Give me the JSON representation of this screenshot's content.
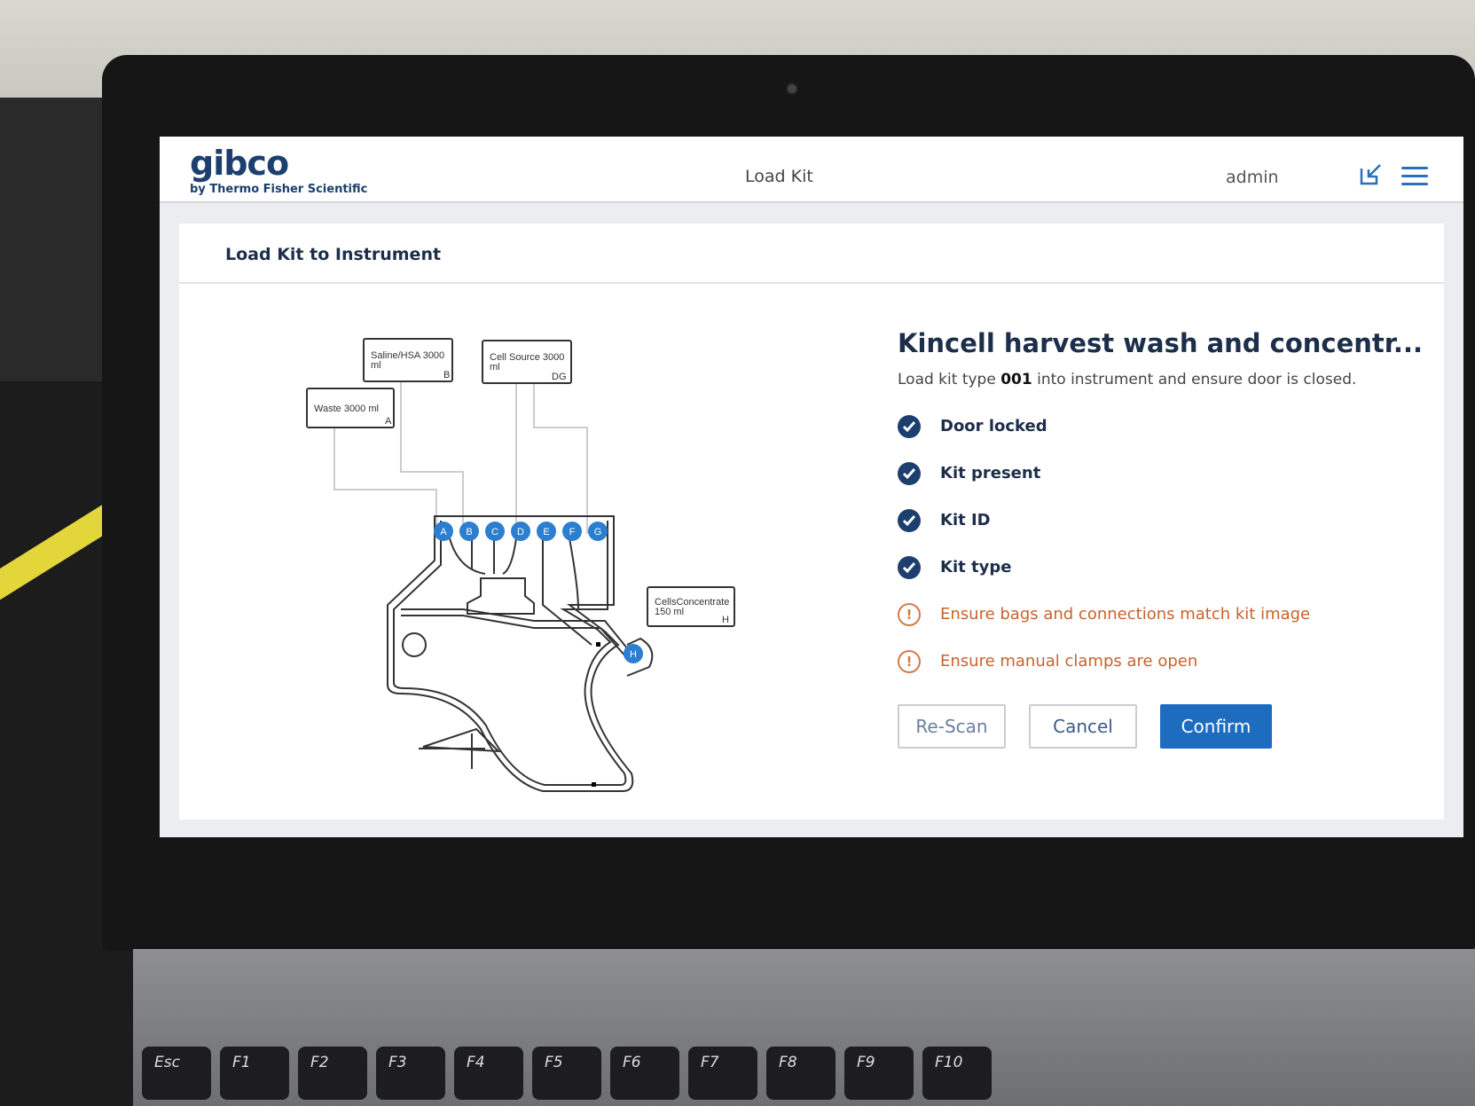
{
  "header": {
    "brand": "gibco",
    "brand_sub": "by Thermo Fisher Scientific",
    "title": "Load Kit",
    "user": "admin",
    "export_icon": "export-icon",
    "menu_icon": "hamburger-menu-icon"
  },
  "panel": {
    "title": "Load Kit to Instrument"
  },
  "diagram": {
    "bags": [
      {
        "label": "Saline/HSA 3000",
        "label2": "ml",
        "port": "B"
      },
      {
        "label": "Cell Source 3000",
        "label2": "ml",
        "port": "DG"
      },
      {
        "label": "Waste 3000 ml",
        "label2": "",
        "port": "A"
      },
      {
        "label": "CellsConcentrate",
        "label2": "150 ml",
        "port": "H"
      }
    ],
    "ports": [
      "A",
      "B",
      "C",
      "D",
      "E",
      "F",
      "G",
      "H"
    ]
  },
  "kit": {
    "title": "Kincell harvest wash and concentr...",
    "desc_before": "Load kit type ",
    "desc_type": "001",
    "desc_after": " into instrument and ensure door is closed.",
    "checks": [
      {
        "label": "Door locked",
        "status": "ok"
      },
      {
        "label": "Kit present",
        "status": "ok"
      },
      {
        "label": "Kit ID",
        "status": "ok"
      },
      {
        "label": "Kit type",
        "status": "ok"
      }
    ],
    "warnings": [
      {
        "label": "Ensure bags and connections match kit image",
        "status": "warning"
      },
      {
        "label": "Ensure manual clamps are open",
        "status": "warning"
      }
    ]
  },
  "buttons": {
    "rescan": "Re-Scan",
    "cancel": "Cancel",
    "confirm": "Confirm"
  },
  "keyboard": [
    "Esc",
    "F1",
    "F2",
    "F3",
    "F4",
    "F5",
    "F6",
    "F7",
    "F8",
    "F9",
    "F10"
  ],
  "colors": {
    "brand": "#1c3f6e",
    "accent": "#1e6cc0",
    "warning": "#c9622c",
    "port": "#2c7fd0"
  }
}
